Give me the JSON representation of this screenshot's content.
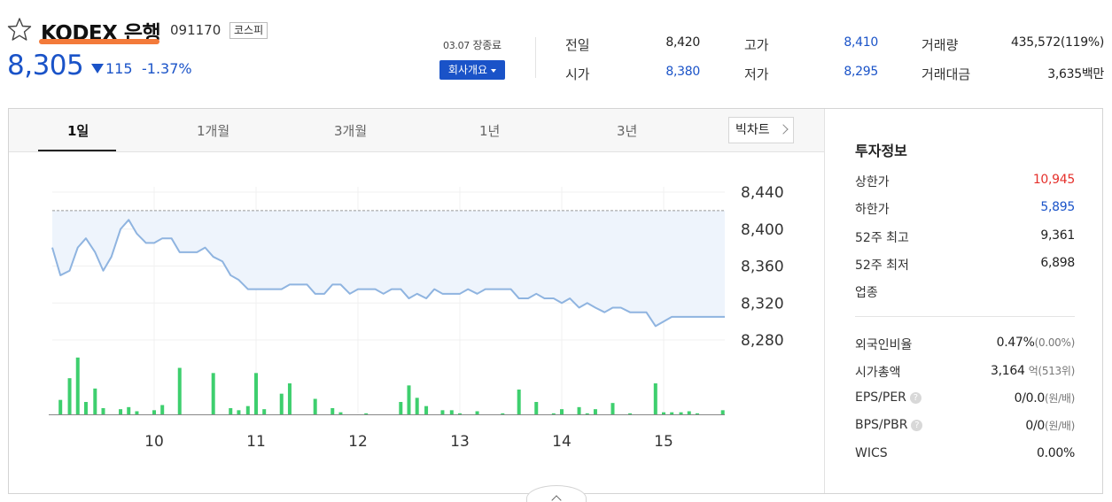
{
  "stock": {
    "name": "KODEX 은행",
    "code": "091170",
    "market": "코스피",
    "price": "8,305",
    "change": "115",
    "change_rate": "-1.37%",
    "date": "03.07",
    "market_status": "장종료",
    "company_button": "회사개요"
  },
  "quote": {
    "prev_close_label": "전일",
    "prev_close": "8,420",
    "open_label": "시가",
    "open": "8,380",
    "high_label": "고가",
    "high": "8,410",
    "low_label": "저가",
    "low": "8,295",
    "volume_label": "거래량",
    "volume": "435,572(119%)",
    "value_label": "거래대금",
    "value": "3,635백만"
  },
  "tabs": [
    {
      "label": "1일"
    },
    {
      "label": "1개월"
    },
    {
      "label": "3개월"
    },
    {
      "label": "1년"
    },
    {
      "label": "3년"
    }
  ],
  "bigchart_label": "빅차트",
  "info": {
    "title": "투자정보",
    "upper_limit_label": "상한가",
    "upper_limit": "10,945",
    "lower_limit_label": "하한가",
    "lower_limit": "5,895",
    "high52_label": "52주 최고",
    "high52": "9,361",
    "low52_label": "52주 최저",
    "low52": "6,898",
    "sector_label": "업종",
    "foreign_label": "외국인비율",
    "foreign": "0.47%",
    "foreign_sub": "(0.00%)",
    "mcap_label": "시가총액",
    "mcap": "3,164",
    "mcap_unit": "억",
    "mcap_sub": "(513위)",
    "eps_label": "EPS/PER",
    "eps": "0/0.0",
    "eps_unit": "(원/배)",
    "bps_label": "BPS/PBR",
    "bps": "0/0",
    "bps_unit": "(원/배)",
    "wics_label": "WICS",
    "wics": "0.00%"
  },
  "colors": {
    "down": "#1a53c8",
    "up": "#e5302b",
    "volume": "#3ecf6e",
    "line": "#8fb4e0",
    "area": "#eef4fc",
    "brand_underline": "#f37a3a"
  },
  "chart_data": {
    "type": "line",
    "y_ticks": [
      "8,440",
      "8,400",
      "8,360",
      "8,320",
      "8,280"
    ],
    "x_ticks": [
      "10",
      "11",
      "12",
      "13",
      "14",
      "15"
    ],
    "ylim": [
      8280,
      8440
    ],
    "xlim": [
      9.0,
      15.6
    ],
    "prev_close": 8420,
    "grid": true,
    "series": [
      {
        "x": [
          9.0,
          9.08,
          9.17,
          9.25,
          9.33,
          9.42,
          9.5,
          9.58,
          9.67,
          9.75,
          9.83,
          9.92,
          10.0,
          10.08,
          10.17,
          10.25,
          10.33,
          10.42,
          10.5,
          10.58,
          10.67,
          10.75,
          10.83,
          10.92,
          11.0,
          11.08,
          11.17,
          11.25,
          11.33,
          11.42,
          11.5,
          11.58,
          11.67,
          11.75,
          11.83,
          11.92,
          12.0,
          12.08,
          12.17,
          12.25,
          12.33,
          12.42,
          12.5,
          12.58,
          12.67,
          12.75,
          12.83,
          12.92,
          13.0,
          13.08,
          13.17,
          13.25,
          13.33,
          13.42,
          13.5,
          13.58,
          13.67,
          13.75,
          13.83,
          13.92,
          14.0,
          14.08,
          14.17,
          14.25,
          14.33,
          14.42,
          14.5,
          14.58,
          14.67,
          14.75,
          14.83,
          14.92,
          15.0,
          15.08,
          15.17,
          15.25,
          15.33,
          15.42,
          15.5,
          15.6
        ],
        "y": [
          8380,
          8350,
          8355,
          8380,
          8390,
          8375,
          8355,
          8370,
          8400,
          8410,
          8395,
          8385,
          8385,
          8390,
          8390,
          8375,
          8375,
          8375,
          8380,
          8370,
          8365,
          8350,
          8345,
          8335,
          8335,
          8335,
          8335,
          8335,
          8340,
          8340,
          8340,
          8330,
          8330,
          8340,
          8340,
          8330,
          8335,
          8335,
          8335,
          8330,
          8335,
          8335,
          8325,
          8330,
          8325,
          8335,
          8330,
          8330,
          8330,
          8335,
          8330,
          8335,
          8335,
          8335,
          8335,
          8325,
          8325,
          8330,
          8325,
          8325,
          8320,
          8325,
          8315,
          8320,
          8315,
          8310,
          8315,
          8315,
          8310,
          8310,
          8310,
          8295,
          8300,
          8305,
          8305,
          8305,
          8305,
          8305,
          8305,
          8305
        ]
      }
    ],
    "volume": {
      "x": [
        9.08,
        9.17,
        9.25,
        9.33,
        9.42,
        9.5,
        9.67,
        9.75,
        9.83,
        10.0,
        10.08,
        10.25,
        10.58,
        10.75,
        10.83,
        10.92,
        11.0,
        11.08,
        11.25,
        11.33,
        11.58,
        11.75,
        11.83,
        12.08,
        12.42,
        12.5,
        12.58,
        12.67,
        12.83,
        12.92,
        13.0,
        13.17,
        13.42,
        13.58,
        13.75,
        13.92,
        14.0,
        14.17,
        14.25,
        14.33,
        14.5,
        14.67,
        14.92,
        15.0,
        15.08,
        15.17,
        15.25,
        15.33,
        15.58
      ],
      "y": [
        14,
        35,
        55,
        12,
        25,
        6,
        5,
        7,
        3,
        4,
        9,
        45,
        40,
        6,
        4,
        8,
        40,
        5,
        20,
        30,
        15,
        6,
        2,
        1,
        12,
        28,
        16,
        8,
        4,
        4,
        1,
        3,
        1,
        24,
        12,
        1,
        5,
        7,
        1,
        5,
        11,
        1,
        30,
        2,
        2,
        2,
        3,
        1,
        4
      ]
    }
  }
}
